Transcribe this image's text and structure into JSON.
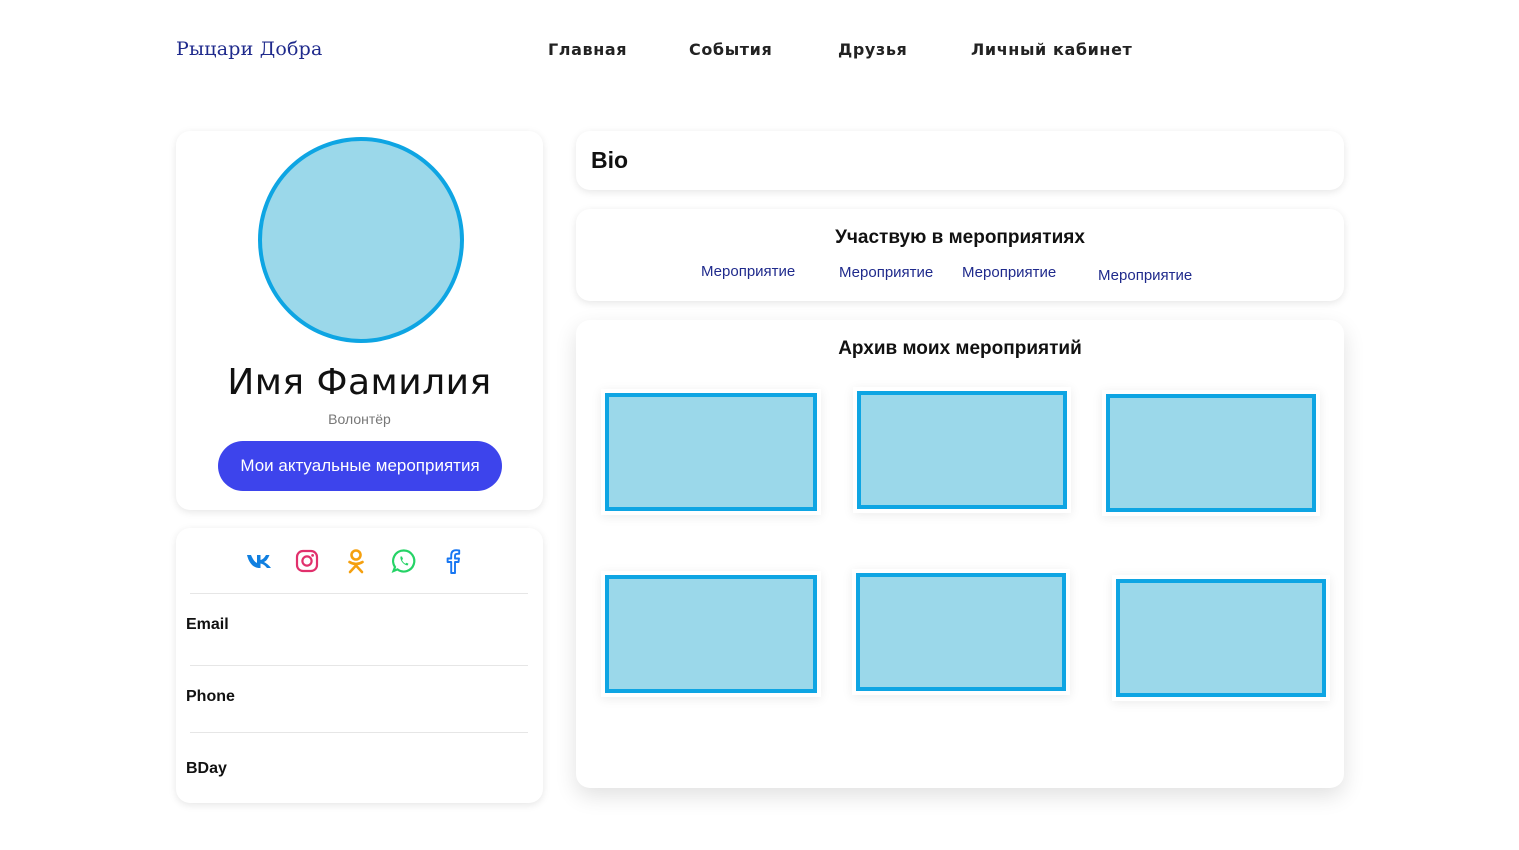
{
  "header": {
    "brand": "Рыцари Добра",
    "nav": [
      "Главная",
      "События",
      "Друзья",
      "Личный кабинет"
    ]
  },
  "profile": {
    "name": "Имя Фамилия",
    "role": "Волонтёр",
    "events_button": "Мои актуальные мероприятия"
  },
  "contacts": {
    "socials": [
      "vk-icon",
      "instagram-icon",
      "odnoklassniki-icon",
      "whatsapp-icon",
      "facebook-icon"
    ],
    "fields": [
      "Email",
      "Phone",
      "BDay"
    ]
  },
  "bio": {
    "title": "Bio"
  },
  "participating": {
    "title": "Участвую в мероприятиях",
    "events": [
      "Мероприятие",
      "Мероприятие",
      "Мероприятие",
      "Мероприятие"
    ]
  },
  "archive": {
    "title": "Архив моих мероприятий"
  },
  "colors": {
    "brand": "#1f2a8c",
    "accent_button": "#3d44ec",
    "placeholder_fill": "#9bd8ea",
    "placeholder_border": "#0ea5e3"
  }
}
